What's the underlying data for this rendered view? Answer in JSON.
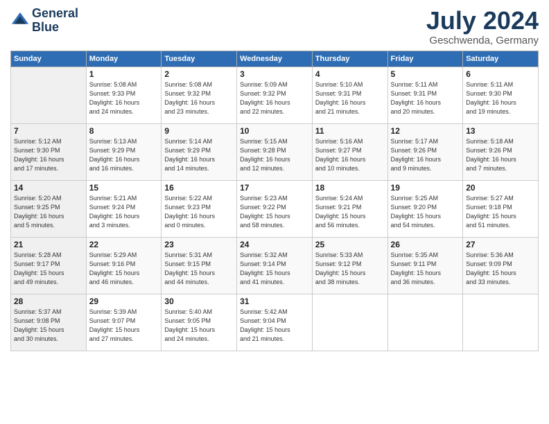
{
  "header": {
    "logo_line1": "General",
    "logo_line2": "Blue",
    "month_year": "July 2024",
    "location": "Geschwenda, Germany"
  },
  "days_of_week": [
    "Sunday",
    "Monday",
    "Tuesday",
    "Wednesday",
    "Thursday",
    "Friday",
    "Saturday"
  ],
  "weeks": [
    [
      {
        "day": "",
        "info": ""
      },
      {
        "day": "1",
        "info": "Sunrise: 5:08 AM\nSunset: 9:33 PM\nDaylight: 16 hours\nand 24 minutes."
      },
      {
        "day": "2",
        "info": "Sunrise: 5:08 AM\nSunset: 9:32 PM\nDaylight: 16 hours\nand 23 minutes."
      },
      {
        "day": "3",
        "info": "Sunrise: 5:09 AM\nSunset: 9:32 PM\nDaylight: 16 hours\nand 22 minutes."
      },
      {
        "day": "4",
        "info": "Sunrise: 5:10 AM\nSunset: 9:31 PM\nDaylight: 16 hours\nand 21 minutes."
      },
      {
        "day": "5",
        "info": "Sunrise: 5:11 AM\nSunset: 9:31 PM\nDaylight: 16 hours\nand 20 minutes."
      },
      {
        "day": "6",
        "info": "Sunrise: 5:11 AM\nSunset: 9:30 PM\nDaylight: 16 hours\nand 19 minutes."
      }
    ],
    [
      {
        "day": "7",
        "info": "Sunrise: 5:12 AM\nSunset: 9:30 PM\nDaylight: 16 hours\nand 17 minutes."
      },
      {
        "day": "8",
        "info": "Sunrise: 5:13 AM\nSunset: 9:29 PM\nDaylight: 16 hours\nand 16 minutes."
      },
      {
        "day": "9",
        "info": "Sunrise: 5:14 AM\nSunset: 9:29 PM\nDaylight: 16 hours\nand 14 minutes."
      },
      {
        "day": "10",
        "info": "Sunrise: 5:15 AM\nSunset: 9:28 PM\nDaylight: 16 hours\nand 12 minutes."
      },
      {
        "day": "11",
        "info": "Sunrise: 5:16 AM\nSunset: 9:27 PM\nDaylight: 16 hours\nand 10 minutes."
      },
      {
        "day": "12",
        "info": "Sunrise: 5:17 AM\nSunset: 9:26 PM\nDaylight: 16 hours\nand 9 minutes."
      },
      {
        "day": "13",
        "info": "Sunrise: 5:18 AM\nSunset: 9:26 PM\nDaylight: 16 hours\nand 7 minutes."
      }
    ],
    [
      {
        "day": "14",
        "info": "Sunrise: 5:20 AM\nSunset: 9:25 PM\nDaylight: 16 hours\nand 5 minutes."
      },
      {
        "day": "15",
        "info": "Sunrise: 5:21 AM\nSunset: 9:24 PM\nDaylight: 16 hours\nand 3 minutes."
      },
      {
        "day": "16",
        "info": "Sunrise: 5:22 AM\nSunset: 9:23 PM\nDaylight: 16 hours\nand 0 minutes."
      },
      {
        "day": "17",
        "info": "Sunrise: 5:23 AM\nSunset: 9:22 PM\nDaylight: 15 hours\nand 58 minutes."
      },
      {
        "day": "18",
        "info": "Sunrise: 5:24 AM\nSunset: 9:21 PM\nDaylight: 15 hours\nand 56 minutes."
      },
      {
        "day": "19",
        "info": "Sunrise: 5:25 AM\nSunset: 9:20 PM\nDaylight: 15 hours\nand 54 minutes."
      },
      {
        "day": "20",
        "info": "Sunrise: 5:27 AM\nSunset: 9:18 PM\nDaylight: 15 hours\nand 51 minutes."
      }
    ],
    [
      {
        "day": "21",
        "info": "Sunrise: 5:28 AM\nSunset: 9:17 PM\nDaylight: 15 hours\nand 49 minutes."
      },
      {
        "day": "22",
        "info": "Sunrise: 5:29 AM\nSunset: 9:16 PM\nDaylight: 15 hours\nand 46 minutes."
      },
      {
        "day": "23",
        "info": "Sunrise: 5:31 AM\nSunset: 9:15 PM\nDaylight: 15 hours\nand 44 minutes."
      },
      {
        "day": "24",
        "info": "Sunrise: 5:32 AM\nSunset: 9:14 PM\nDaylight: 15 hours\nand 41 minutes."
      },
      {
        "day": "25",
        "info": "Sunrise: 5:33 AM\nSunset: 9:12 PM\nDaylight: 15 hours\nand 38 minutes."
      },
      {
        "day": "26",
        "info": "Sunrise: 5:35 AM\nSunset: 9:11 PM\nDaylight: 15 hours\nand 36 minutes."
      },
      {
        "day": "27",
        "info": "Sunrise: 5:36 AM\nSunset: 9:09 PM\nDaylight: 15 hours\nand 33 minutes."
      }
    ],
    [
      {
        "day": "28",
        "info": "Sunrise: 5:37 AM\nSunset: 9:08 PM\nDaylight: 15 hours\nand 30 minutes."
      },
      {
        "day": "29",
        "info": "Sunrise: 5:39 AM\nSunset: 9:07 PM\nDaylight: 15 hours\nand 27 minutes."
      },
      {
        "day": "30",
        "info": "Sunrise: 5:40 AM\nSunset: 9:05 PM\nDaylight: 15 hours\nand 24 minutes."
      },
      {
        "day": "31",
        "info": "Sunrise: 5:42 AM\nSunset: 9:04 PM\nDaylight: 15 hours\nand 21 minutes."
      },
      {
        "day": "",
        "info": ""
      },
      {
        "day": "",
        "info": ""
      },
      {
        "day": "",
        "info": ""
      }
    ]
  ]
}
